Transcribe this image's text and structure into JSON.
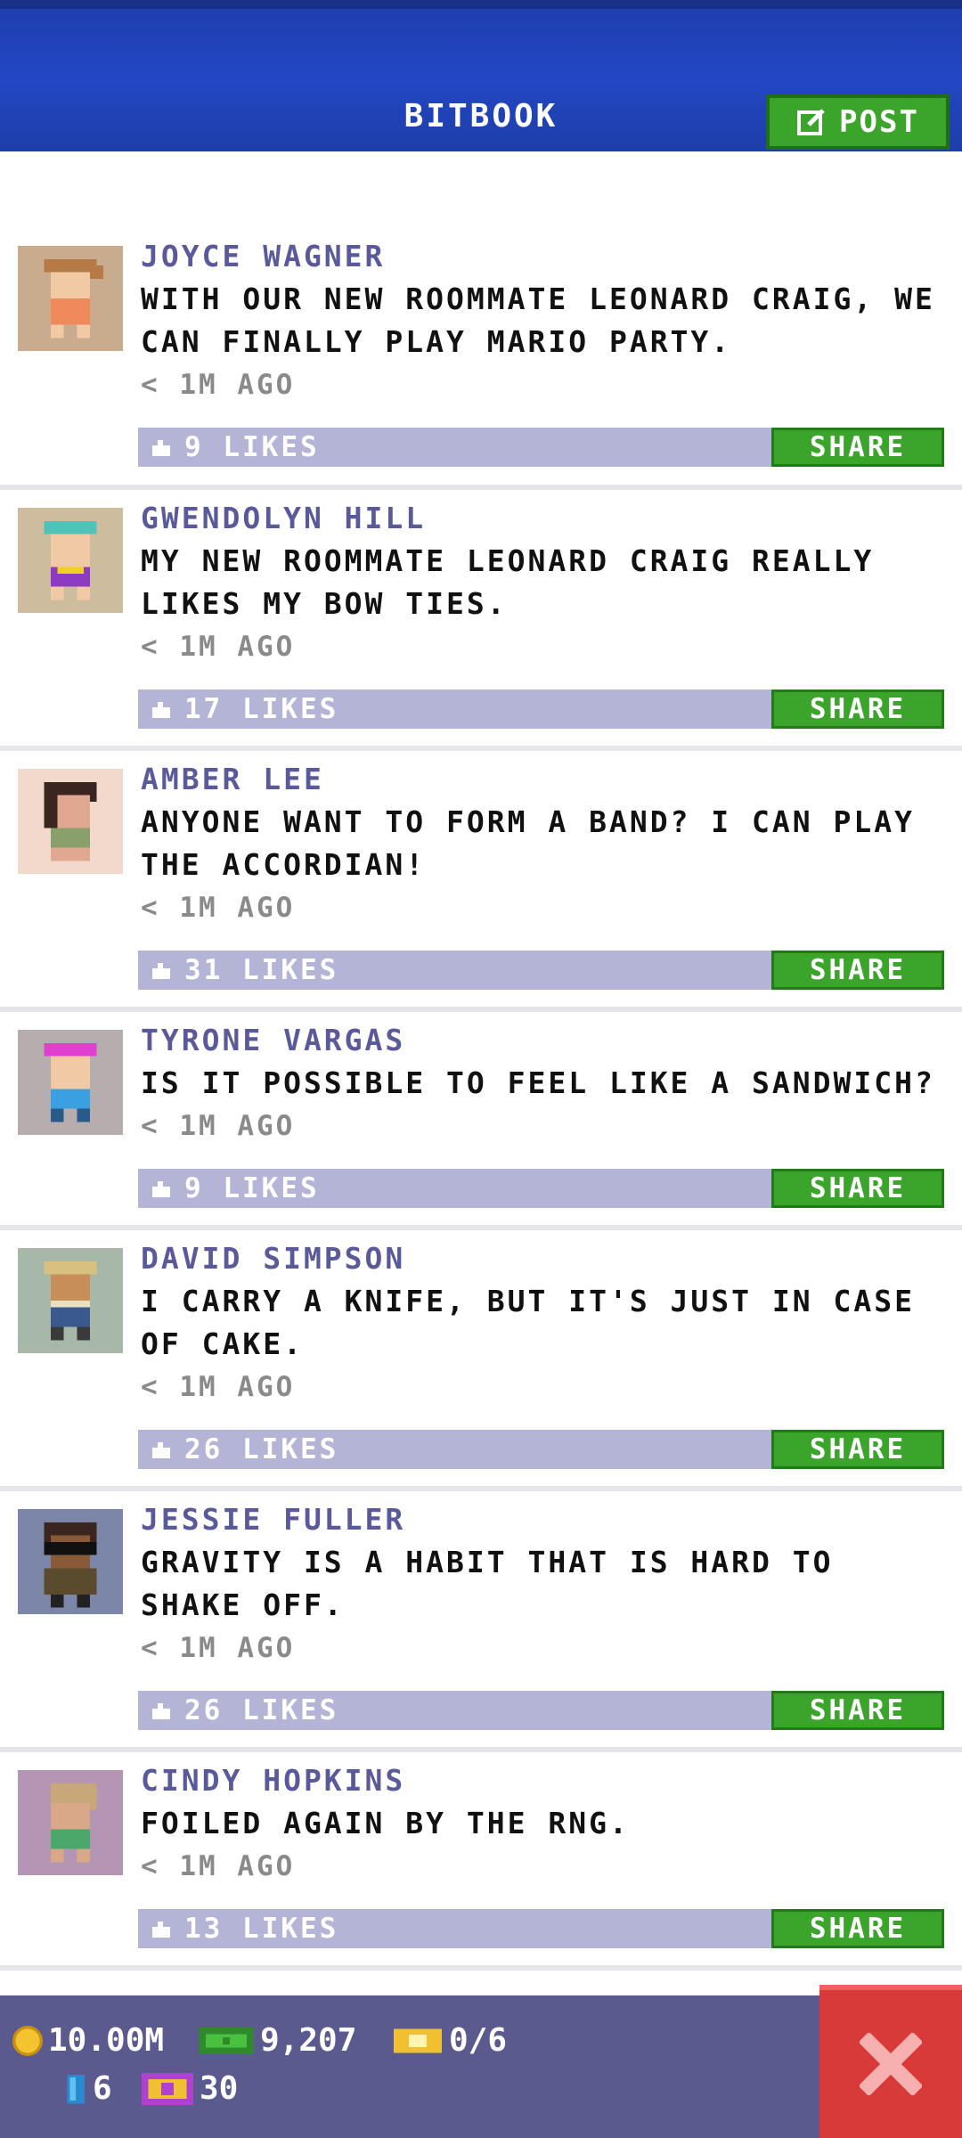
{
  "header": {
    "title": "BITBOOK",
    "post_label": "POST"
  },
  "posts": [
    {
      "author": "JOYCE WAGNER",
      "message": "WITH OUR NEW ROOMMATE LEONARD CRAIG, WE CAN FINALLY PLAY MARIO PARTY.",
      "time": "< 1M AGO",
      "likes": "9 LIKES",
      "share": "SHARE"
    },
    {
      "author": "GWENDOLYN HILL",
      "message": "MY NEW ROOMMATE LEONARD CRAIG REALLY LIKES MY BOW TIES.",
      "time": "< 1M AGO",
      "likes": "17 LIKES",
      "share": "SHARE"
    },
    {
      "author": "AMBER LEE",
      "message": "ANYONE WANT TO FORM A BAND? I CAN PLAY THE ACCORDIAN!",
      "time": "< 1M AGO",
      "likes": "31 LIKES",
      "share": "SHARE"
    },
    {
      "author": "TYRONE VARGAS",
      "message": "IS IT POSSIBLE TO FEEL LIKE A SANDWICH?",
      "time": "< 1M AGO",
      "likes": "9 LIKES",
      "share": "SHARE"
    },
    {
      "author": "DAVID SIMPSON",
      "message": "I CARRY A KNIFE, BUT IT'S JUST IN CASE OF CAKE.",
      "time": "< 1M AGO",
      "likes": "26 LIKES",
      "share": "SHARE"
    },
    {
      "author": "JESSIE FULLER",
      "message": "GRAVITY IS A HABIT THAT IS HARD TO SHAKE OFF.",
      "time": "< 1M AGO",
      "likes": "26 LIKES",
      "share": "SHARE"
    },
    {
      "author": "CINDY HOPKINS",
      "message": "FOILED AGAIN BY THE RNG.",
      "time": "< 1M AGO",
      "likes": "13 LIKES",
      "share": "SHARE"
    }
  ],
  "footer": {
    "coins": "10.00M",
    "bux": "9,207",
    "tickets": "0/6",
    "keys": "6",
    "vip": "30"
  },
  "icons": {
    "post": "edit-icon",
    "like": "thumbs-up-icon",
    "coin": "coin-icon",
    "bux": "cash-icon",
    "ticket": "ticket-icon",
    "key": "key-icon",
    "vip": "vip-icon",
    "close": "close-icon"
  },
  "colors": {
    "header": "#2346c4",
    "accent_green": "#3aa52a",
    "likes_bar": "#b4b4d6",
    "author": "#5a5a9a",
    "footer": "#5a5a8e",
    "close": "#d83a3a"
  }
}
